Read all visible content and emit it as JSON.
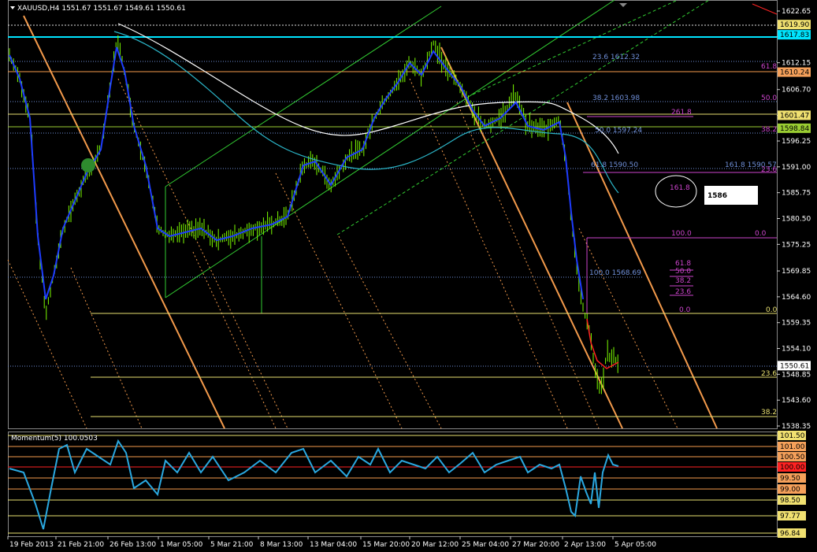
{
  "window": {
    "symbol_header": "XAUUSD,H4  1551.67 1551.67 1549.61 1550.61"
  },
  "colors": {
    "background": "#000000",
    "candle": "#7cfc00",
    "ma_blue": "#1e3cff",
    "ma_cyan": "#2bb5c8",
    "ma_white": "#ffffff",
    "channel_orange": "#f39a4b",
    "channel_green": "#32cd32",
    "fib_magenta": "#cc44cc",
    "fib_blue": "#6f8fd8",
    "yellow": "#e8e070",
    "momentum": "#2aa8e0",
    "red": "#ff2222"
  },
  "price_axis": {
    "ticks": [
      "1622.65",
      "1617.40",
      "1612.15",
      "1606.70",
      "1601.45",
      "1596.25",
      "1591.00",
      "1585.75",
      "1580.50",
      "1575.25",
      "1569.85",
      "1564.60",
      "1559.35",
      "1554.10",
      "1548.85",
      "1543.60",
      "1538.35"
    ],
    "badges": [
      {
        "text": "1619.90",
        "price": 1619.9,
        "bg": "#f0e070",
        "fg": "#000000"
      },
      {
        "text": "1617.83",
        "price": 1617.83,
        "bg": "#00e5ff",
        "fg": "#000000"
      },
      {
        "text": "1610.24",
        "price": 1610.24,
        "bg": "#f5a05a",
        "fg": "#000000"
      },
      {
        "text": "1601.47",
        "price": 1601.47,
        "bg": "#f0e070",
        "fg": "#000000"
      },
      {
        "text": "1598.84",
        "price": 1598.84,
        "bg": "#9acd32",
        "fg": "#000000"
      },
      {
        "text": "1550.61",
        "price": 1550.61,
        "bg": "#ffffff",
        "fg": "#000000"
      }
    ]
  },
  "time_axis": {
    "labels": [
      "19 Feb 2013",
      "21 Feb 21:00",
      "26 Feb 13:00",
      "1 Mar 05:00",
      "5 Mar 21:00",
      "8 Mar 13:00",
      "13 Mar 04:00",
      "15 Mar 20:00",
      "20 Mar 12:00",
      "25 Mar 04:00",
      "27 Mar 20:00",
      "2 Apr 13:00",
      "5 Apr 05:00"
    ]
  },
  "fib_labels": {
    "blue_set": [
      {
        "text": "23.6  1612.32"
      },
      {
        "text": "38.2  1603.98"
      },
      {
        "text": "50.0  1597.24"
      },
      {
        "text": "61.8  1590.50"
      },
      {
        "text": "100.0  1568.69"
      }
    ],
    "right_blue": "161.8  1590.57",
    "magenta_set": [
      "61.8",
      "50.0",
      "261.8",
      "38.2",
      "23.6",
      "161.8",
      "100.0",
      "0.0",
      "61.8",
      "50.0",
      "38.2",
      "23.6",
      "0.0"
    ],
    "yellow_set": [
      "23.6",
      "38.2"
    ]
  },
  "annotation": {
    "circle_label": "161.8",
    "box_label": "1586"
  },
  "momentum": {
    "title": "Momentum(5) 100.0503",
    "ticks": [
      {
        "text": "101.50",
        "bg": "#f0e070"
      },
      {
        "text": "101.00",
        "bg": "#f5a05a"
      },
      {
        "text": "100.50",
        "bg": "#f5a05a"
      },
      {
        "text": "100.00",
        "bg": "#ff2222"
      },
      {
        "text": "99.50",
        "bg": "#f5a05a"
      },
      {
        "text": "99.00",
        "bg": "#f5a05a"
      },
      {
        "text": "98.50",
        "bg": "#f0e070"
      },
      {
        "text": "97.77",
        "bg": "#f0e070"
      },
      {
        "text": "96.84",
        "bg": "#f0e070"
      }
    ]
  }
}
